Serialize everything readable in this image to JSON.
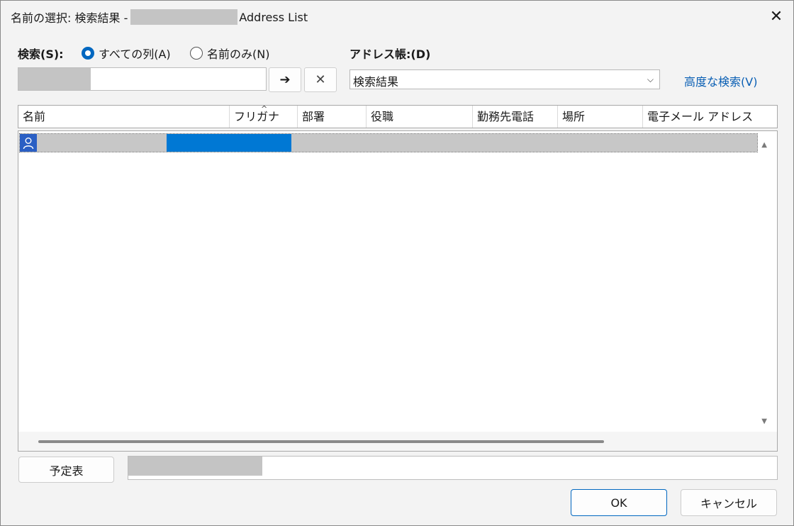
{
  "window": {
    "title_prefix": "名前の選択: 検索結果 -",
    "title_suffix": "Address List",
    "close_glyph": "✕"
  },
  "search": {
    "label": "検索(S):",
    "radio_all_label": "すべての列(A)",
    "radio_all_selected": true,
    "radio_name_label": "名前のみ(N)",
    "go_glyph": "➔",
    "clear_glyph": "✕"
  },
  "address_book": {
    "label": "アドレス帳:(D)",
    "selected": "検索結果",
    "dropdown_glyph": "⌵",
    "advanced_link": "高度な検索(V)"
  },
  "list": {
    "columns": [
      "名前",
      "フリガナ",
      "部署",
      "役職",
      "勤務先電話",
      "場所",
      "電子メール アドレス"
    ],
    "sorted_column": "フリガナ",
    "sort_glyph": "^",
    "row_count": 1
  },
  "footer": {
    "calendar_button": "予定表",
    "ok_button": "OK",
    "cancel_button": "キャンセル"
  },
  "icons": [
    "close-icon",
    "arrow-right-icon",
    "clear-icon",
    "chevron-down-icon",
    "person-icon",
    "scroll-up-icon",
    "scroll-down-icon"
  ],
  "colors": {
    "accent": "#0067c0",
    "selection": "#0078d4",
    "link": "#0a5fb4"
  }
}
